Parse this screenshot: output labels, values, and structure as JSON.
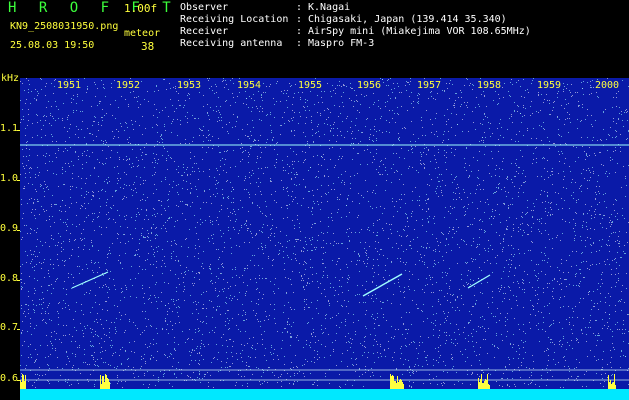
{
  "header": {
    "app_title": "H R O F F T",
    "version": "1.00f",
    "filename": "KN9_2508031950.png",
    "timestamp": "25.08.03 19:50",
    "meteor_label": "meteor",
    "meteor_count": "38"
  },
  "info": [
    {
      "key": "Observer",
      "value": "K.Nagai"
    },
    {
      "key": "Receiving Location",
      "value": "Chigasaki, Japan (139.414 35.340)"
    },
    {
      "key": "Receiver",
      "value": "AirSpy mini (Miakejima VOR 108.65MHz)"
    },
    {
      "key": "Receiving antenna",
      "value": "Maspro FM-3"
    }
  ],
  "plot": {
    "y_unit": "kHz",
    "y_ticks": [
      "1.1",
      "1.0",
      "0.9",
      "0.8",
      "0.7",
      "0.6"
    ],
    "x_ticks": [
      "1951",
      "1952",
      "1953",
      "1954",
      "1955",
      "1956",
      "1957",
      "1958",
      "1959",
      "2000"
    ],
    "colors": {
      "background": "#0a1aa8",
      "noise": "#ffffff",
      "signal": "#ffff40",
      "echo": "#9fffff",
      "axis": "#ffff3c"
    }
  }
}
